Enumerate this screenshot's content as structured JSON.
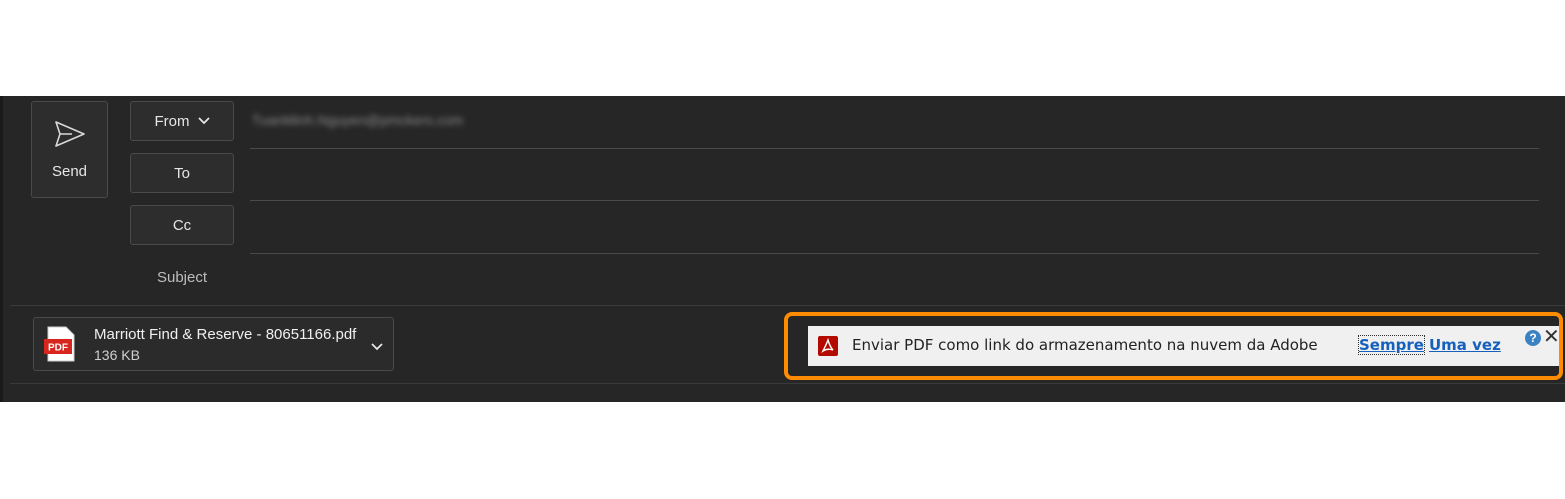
{
  "compose": {
    "send_label": "Send",
    "from_label": "From",
    "to_label": "To",
    "cc_label": "Cc",
    "subject_label": "Subject",
    "from_address": "TuanMinh.Nguyen@pmckers.com"
  },
  "attachment": {
    "name": "Marriott Find & Reserve - 80651166.pdf",
    "size": "136 KB",
    "icon_text": "PDF"
  },
  "adobe_bar": {
    "message": "Enviar PDF como link do armazenamento na nuvem da Adobe",
    "always_label": "Sempre",
    "once_label": "Uma vez",
    "help_label": "?"
  },
  "colors": {
    "highlight": "#ff8c00",
    "pdf_red": "#d7261e",
    "link_blue": "#1560bd"
  }
}
